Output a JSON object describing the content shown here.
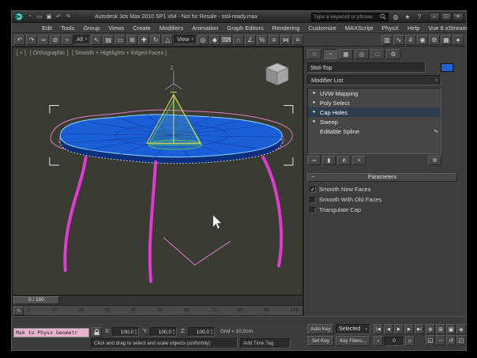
{
  "ui": {
    "dropdown_arrow": "▾",
    "spinner_up": "▲",
    "spinner_down": "▼"
  },
  "titlebar": {
    "title": "Autodesk 3ds Max 2010 SP1 x64  - Not for Resale -  stol-ready.max",
    "search_placeholder": "Type a keyword or phrase",
    "quick_access": [
      {
        "name": "new-scene",
        "glyph": "▫"
      },
      {
        "name": "open-file",
        "glyph": "▭"
      },
      {
        "name": "save-file",
        "glyph": "▣"
      },
      {
        "name": "undo-quick",
        "glyph": "↶"
      },
      {
        "name": "redo-quick",
        "glyph": "↷"
      }
    ],
    "infocenter_icons": [
      {
        "name": "communication-center",
        "glyph": "◍"
      },
      {
        "name": "favorites",
        "glyph": "★"
      },
      {
        "name": "help",
        "glyph": "?"
      }
    ],
    "window": {
      "minimize": "–",
      "maximize": "□",
      "close": "×"
    }
  },
  "menubar": {
    "items": [
      "Edit",
      "Tools",
      "Group",
      "Views",
      "Create",
      "Modifiers",
      "Animation",
      "Graph Editors",
      "Rendering",
      "Customize",
      "MAXScript",
      "PhysX",
      "Help",
      "Vue 8 xStream"
    ]
  },
  "toolbar": {
    "selection_filter": "All",
    "reference_coordsys": "View",
    "icons": [
      {
        "name": "undo",
        "glyph": "↶"
      },
      {
        "name": "redo",
        "glyph": "↷"
      },
      {
        "name": "select-and-link",
        "glyph": "∞"
      },
      {
        "name": "unlink-selection",
        "glyph": "⊘"
      },
      {
        "name": "bind-to-space-warp",
        "glyph": "≈"
      },
      {
        "name": "select-object",
        "glyph": "↖"
      },
      {
        "name": "select-by-name",
        "glyph": "▤"
      },
      {
        "name": "rectangular-selection-region",
        "glyph": "▭"
      },
      {
        "name": "window-crossing",
        "glyph": "⊞"
      },
      {
        "name": "select-and-move",
        "glyph": "✚"
      },
      {
        "name": "select-and-rotate",
        "glyph": "↻"
      },
      {
        "name": "select-and-uniform-scale",
        "glyph": "△"
      },
      {
        "name": "use-pivot-point-center",
        "glyph": "◎"
      },
      {
        "name": "select-and-manipulate",
        "glyph": "◆"
      },
      {
        "name": "keyboard-shortcut-override",
        "glyph": "⌨"
      },
      {
        "name": "snaps-toggle",
        "glyph": "∩"
      },
      {
        "name": "angle-snap-toggle",
        "glyph": "∠"
      },
      {
        "name": "percent-snap-toggle",
        "glyph": "%"
      },
      {
        "name": "spinner-snap-toggle",
        "glyph": "≑"
      },
      {
        "name": "mirror",
        "glyph": "⋈"
      },
      {
        "name": "align",
        "glyph": "≡"
      },
      {
        "name": "layer-manager",
        "glyph": "▥"
      },
      {
        "name": "curve-editor",
        "glyph": "∿"
      },
      {
        "name": "schematic-view",
        "glyph": "#"
      },
      {
        "name": "material-editor",
        "glyph": "◉"
      },
      {
        "name": "render-setup",
        "glyph": "⚙"
      },
      {
        "name": "rendered-frame-window",
        "glyph": "▦"
      },
      {
        "name": "render-production",
        "glyph": "●"
      }
    ]
  },
  "viewport": {
    "nav_menu": "[ + ]",
    "pov_label": "[ Orthographic ]",
    "shading_label": "[ Smooth + Highlights + Edged Faces ]",
    "axis_z": "Z"
  },
  "command_panel": {
    "tabs": [
      {
        "name": "create",
        "glyph": "☆"
      },
      {
        "name": "modify",
        "glyph": "◔"
      },
      {
        "name": "hierarchy",
        "glyph": "▦"
      },
      {
        "name": "motion",
        "glyph": "◎"
      },
      {
        "name": "display",
        "glyph": "□"
      },
      {
        "name": "utilities",
        "glyph": "⚙"
      }
    ],
    "object_name": "Stol-Top",
    "object_color": "#1e63d6",
    "modifier_list_label": "Modifier List",
    "stack": [
      {
        "label": "UVW Mapping",
        "bulb": "●",
        "selected": false,
        "suffix": ""
      },
      {
        "label": "Poly Select",
        "bulb": "●",
        "selected": false,
        "suffix": ""
      },
      {
        "label": "Cap Holes",
        "bulb": "●",
        "selected": true,
        "suffix": ""
      },
      {
        "label": "Sweep",
        "bulb": "●",
        "selected": false,
        "suffix": ""
      },
      {
        "label": "Editable Spline",
        "bulb": "",
        "selected": false,
        "suffix": "∿"
      }
    ],
    "stack_buttons": [
      {
        "name": "pin-stack",
        "glyph": "⊸"
      },
      {
        "name": "show-end-result",
        "glyph": "▮"
      },
      {
        "name": "make-unique",
        "glyph": "⋔"
      },
      {
        "name": "remove-modifier",
        "glyph": "×"
      },
      {
        "name": "configure-modifier-sets",
        "glyph": "⚙"
      }
    ],
    "rollout": {
      "collapse": "−",
      "title": "Parameters",
      "checkboxes": [
        {
          "label": "Smooth New Faces",
          "checked": true,
          "mark": "✓"
        },
        {
          "label": "Smooth With Old Faces",
          "checked": false,
          "mark": ""
        },
        {
          "label": "Triangulate Cap",
          "checked": false,
          "mark": ""
        }
      ]
    }
  },
  "timeline": {
    "slider_label": "0 / 100",
    "mini_curve_glyph": "∿",
    "ticks": [
      "0",
      "10",
      "20",
      "30",
      "40",
      "50",
      "60",
      "70",
      "80",
      "90",
      "100"
    ]
  },
  "statusbar": {
    "listener": "Mak to Physx Geometr",
    "prompt": "Click and drag to select and scale objects (uniformly)",
    "add_time_tag": "Add Time Tag",
    "grid": "Grid = 10,0cm",
    "coord_x_label": "X:",
    "coord_x": "100,0",
    "coord_y_label": "Y:",
    "coord_y": "100,0",
    "coord_z_label": "Z:",
    "coord_z": "100,0",
    "auto_key": "Auto Key",
    "set_key": "Set Key",
    "selection_set": "Selected",
    "key_filters": "Key Filters...",
    "frame": "0",
    "key_mode_glyph": "▪",
    "time_config_glyph": "◷",
    "playback": [
      {
        "name": "go-to-start",
        "glyph": "|◀"
      },
      {
        "name": "previous-frame",
        "glyph": "◀"
      },
      {
        "name": "play-animation",
        "glyph": "▶"
      },
      {
        "name": "next-frame",
        "glyph": "▶"
      },
      {
        "name": "go-to-end",
        "glyph": "▶|"
      }
    ],
    "nav": [
      {
        "name": "zoom",
        "glyph": "⊕"
      },
      {
        "name": "zoom-all",
        "glyph": "⊞"
      },
      {
        "name": "zoom-extents",
        "glyph": "▣"
      },
      {
        "name": "zoom-extents-all",
        "glyph": "◈"
      },
      {
        "name": "zoom-region",
        "glyph": "◱"
      },
      {
        "name": "pan-view",
        "glyph": "↔"
      },
      {
        "name": "orbit-view",
        "glyph": "↺"
      },
      {
        "name": "maximize-viewport",
        "glyph": "◰"
      }
    ]
  }
}
